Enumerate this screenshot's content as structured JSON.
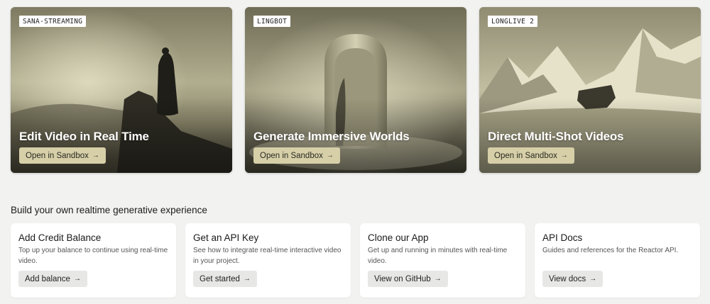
{
  "heroes": [
    {
      "tag": "SANA-STREAMING",
      "title": "Edit Video in Real Time",
      "button_label": "Open in Sandbox",
      "button_icon": "arrow-right-icon"
    },
    {
      "tag": "LINGBOT",
      "title": "Generate Immersive Worlds",
      "button_label": "Open in Sandbox",
      "button_icon": "arrow-right-icon"
    },
    {
      "tag": "LONGLIVE 2",
      "title": "Direct Multi-Shot Videos",
      "button_label": "Open in Sandbox",
      "button_icon": "arrow-right-icon"
    }
  ],
  "section": {
    "title": "Build your own realtime generative experience"
  },
  "cards": [
    {
      "title": "Add Credit Balance",
      "description": "Top up your balance to continue using real-time video.",
      "button_label": "Add balance"
    },
    {
      "title": "Get an API Key",
      "description": "See how to integrate real-time interactive video in your project.",
      "button_label": "Get started"
    },
    {
      "title": "Clone our App",
      "description": "Get up and running in minutes with real-time video.",
      "button_label": "View on GitHub"
    },
    {
      "title": "API Docs",
      "description": "Guides and references for the Reactor API.",
      "button_label": "View docs"
    }
  ],
  "arrow_glyph": "→",
  "colors": {
    "hero_button": "#d6cfa8",
    "card_button": "#e7e7e6",
    "page_bg": "#f2f2f1"
  }
}
